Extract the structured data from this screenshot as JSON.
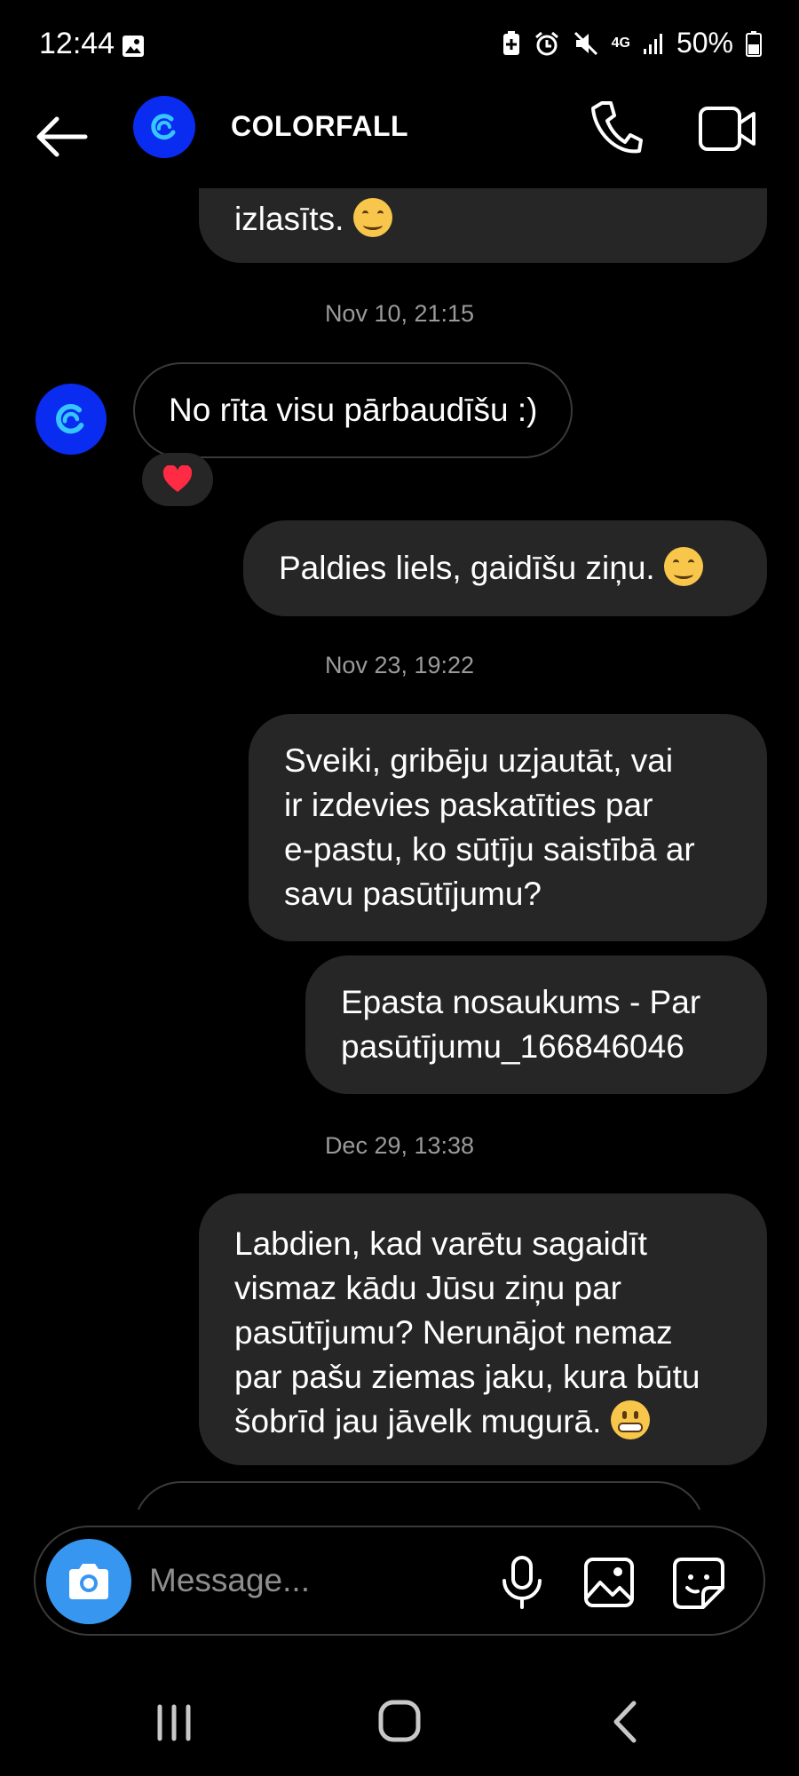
{
  "status_bar": {
    "time": "12:44",
    "network": "4G",
    "battery": "50%",
    "icons": [
      "gallery-notification-icon",
      "battery-saver-icon",
      "alarm-icon",
      "mute-icon",
      "signal-icon",
      "battery-icon"
    ]
  },
  "header": {
    "contact_name": "COLORFALL",
    "icons": [
      "back-arrow-icon",
      "brand-logo-icon",
      "phone-call-icon",
      "video-call-icon"
    ]
  },
  "messages": {
    "partial_out_text": "izlasīts.",
    "ts1": "Nov 10, 21:15",
    "in1_text": "No rīta visu pārbaudīšu :)",
    "in1_reaction": "heart",
    "out1_text": "Paldies liels, gaidīšu ziņu.",
    "ts2": "Nov 23, 19:22",
    "out2_lines": [
      "Sveiki, gribēju uzjautāt, vai",
      "ir izdevies paskatīties par",
      "e-pastu, ko sūtīju saistībā ar",
      "savu pasūtījumu?"
    ],
    "out3_lines": [
      "Epasta nosaukums - Par",
      "pasūtījumu_166846046"
    ],
    "ts3": "Dec 29, 13:38",
    "out4_lines": [
      "Labdien, kad varētu sagaidīt",
      "vismaz kādu Jūsu ziņu par",
      "pasūtījumu? Nerunājot nemaz",
      "par pašu ziemas jaku, kura būtu",
      "šobrīd jau jāvelk mugurā."
    ]
  },
  "composer": {
    "placeholder": "Message...",
    "icons": [
      "camera-icon",
      "microphone-icon",
      "gallery-icon",
      "sticker-icon"
    ]
  },
  "colors": {
    "background": "#000000",
    "bubble_outgoing": "#262626",
    "brand_blue": "#0a2bf0",
    "camera_blue": "#3797f0",
    "timestamp": "#9a9a9a"
  },
  "nav_bar": {
    "icons": [
      "recent-apps-icon",
      "home-icon",
      "back-icon"
    ]
  }
}
